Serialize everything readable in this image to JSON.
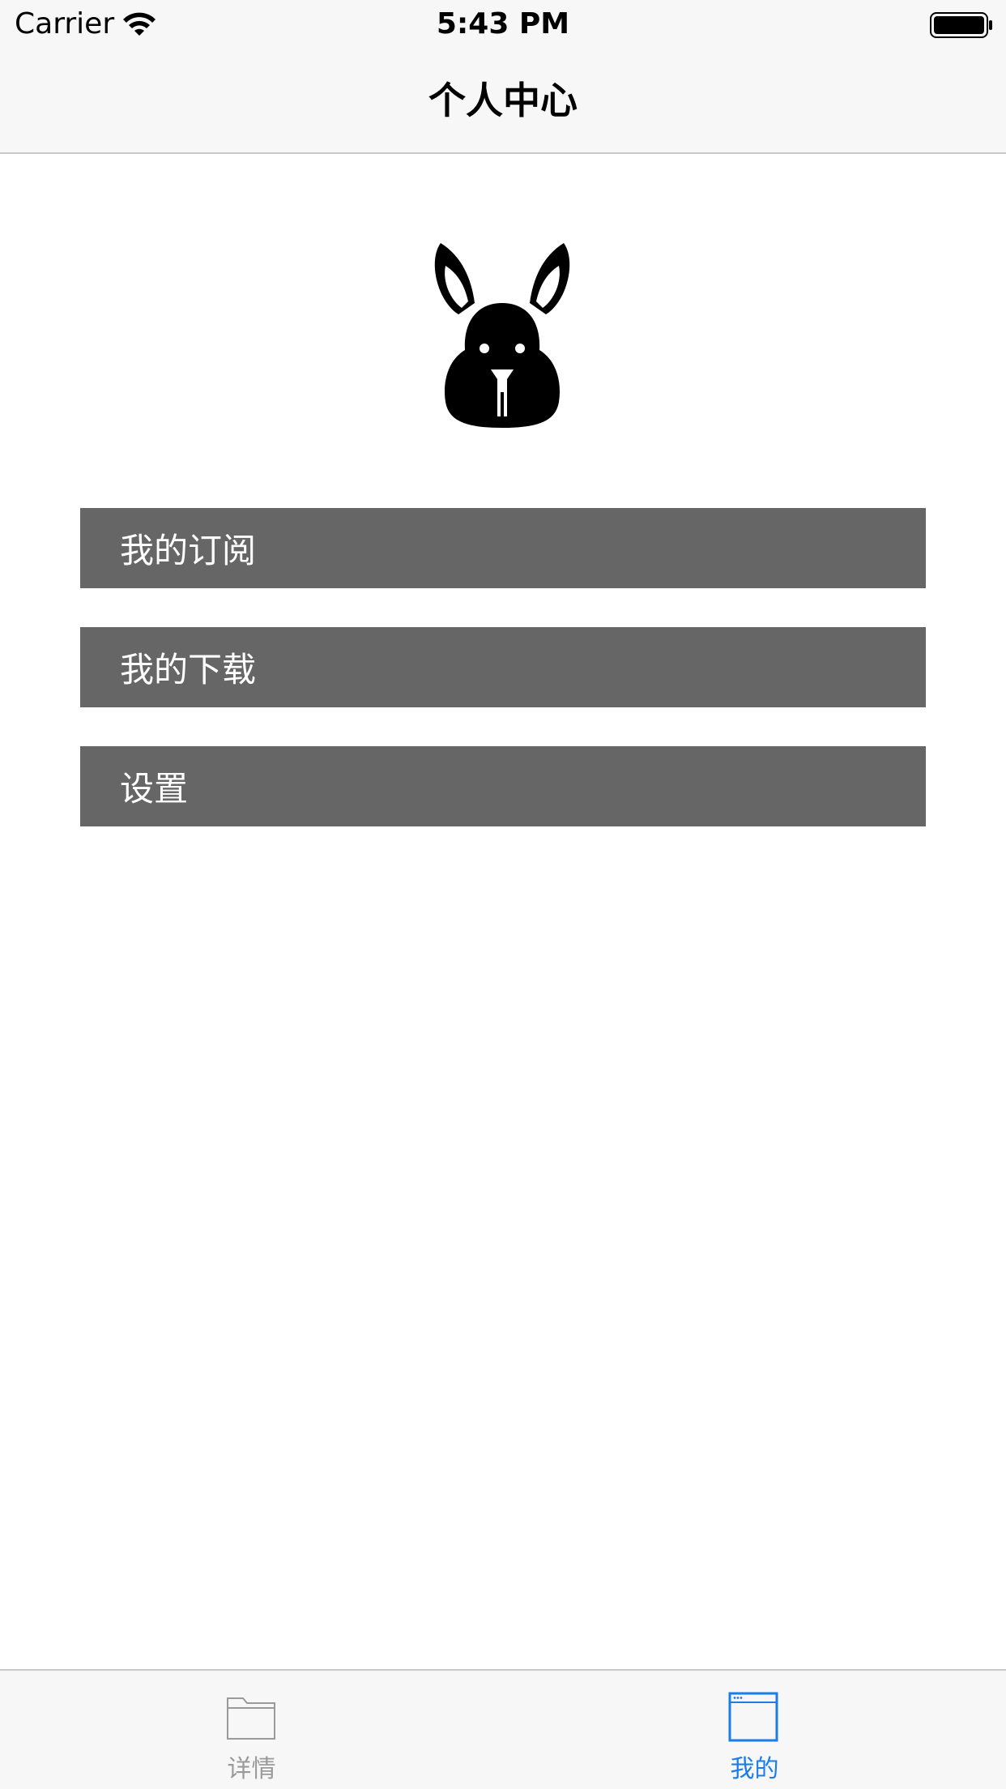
{
  "status_bar": {
    "carrier": "Carrier",
    "time": "5:43 PM"
  },
  "nav": {
    "title": "个人中心"
  },
  "avatar": {
    "icon": "rabbit-icon"
  },
  "menu": {
    "items": [
      {
        "label": "我的订阅"
      },
      {
        "label": "我的下载"
      },
      {
        "label": "设置"
      }
    ]
  },
  "tabbar": {
    "tabs": [
      {
        "label": "详情",
        "icon": "folder-icon",
        "selected": false
      },
      {
        "label": "我的",
        "icon": "window-icon",
        "selected": true
      }
    ]
  },
  "colors": {
    "tab_active": "#1a7de8",
    "tab_inactive": "#9a9a9a",
    "menu_background": "#666666",
    "menu_text": "#ffffff",
    "bar_background": "#f7f7f7"
  }
}
